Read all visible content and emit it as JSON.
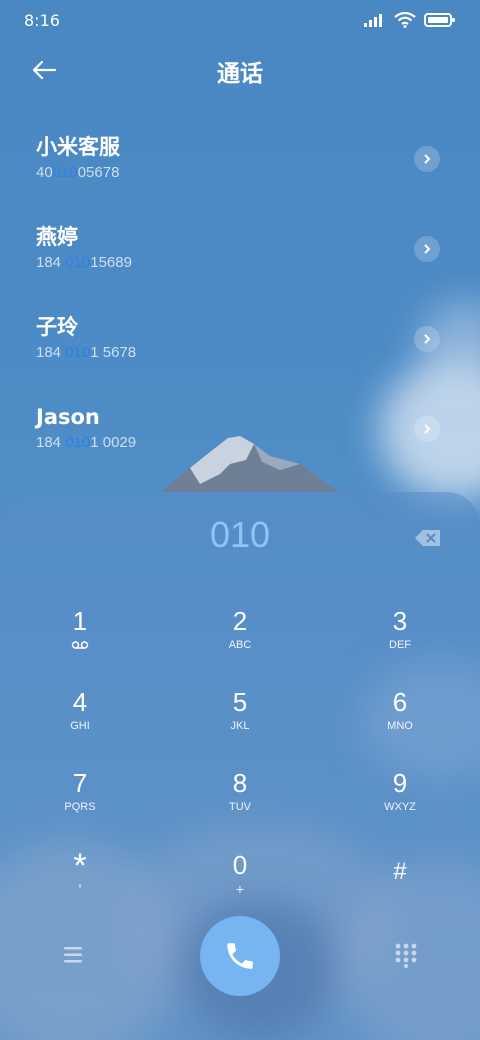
{
  "status_bar": {
    "time": "8:16"
  },
  "header": {
    "title": "通话"
  },
  "contacts": [
    {
      "name": "小米客服",
      "number_before": "40",
      "number_match": "010",
      "number_after": "05678"
    },
    {
      "name": "燕婷",
      "number_before": "184 ",
      "number_match": "010",
      "number_after": "15689"
    },
    {
      "name": "子玲",
      "number_before": "184 ",
      "number_match": "010",
      "number_after": "1 5678"
    },
    {
      "name": "Jason",
      "number_before": "184 ",
      "number_match": "010",
      "number_after": "1 0029"
    }
  ],
  "dialer": {
    "entry": "010",
    "keys": [
      {
        "digit": "1",
        "letters": ""
      },
      {
        "digit": "2",
        "letters": "ABC"
      },
      {
        "digit": "3",
        "letters": "DEF"
      },
      {
        "digit": "4",
        "letters": "GHI"
      },
      {
        "digit": "5",
        "letters": "JKL"
      },
      {
        "digit": "6",
        "letters": "MNO"
      },
      {
        "digit": "7",
        "letters": "PQRS"
      },
      {
        "digit": "8",
        "letters": "TUV"
      },
      {
        "digit": "9",
        "letters": "WXYZ"
      },
      {
        "digit": "*",
        "letters": ","
      },
      {
        "digit": "0",
        "letters": "+"
      },
      {
        "digit": "#",
        "letters": ""
      }
    ]
  },
  "icons": {
    "back": "arrow-left-icon",
    "chevron": "chevron-right-icon",
    "voicemail": "voicemail-icon",
    "backspace": "backspace-icon",
    "call": "phone-icon",
    "menu": "menu-icon",
    "keypad": "dialpad-icon"
  },
  "colors": {
    "match_highlight": "#2f7fe6",
    "entry": "#90c4f5",
    "call_button": "#77b4f2"
  }
}
